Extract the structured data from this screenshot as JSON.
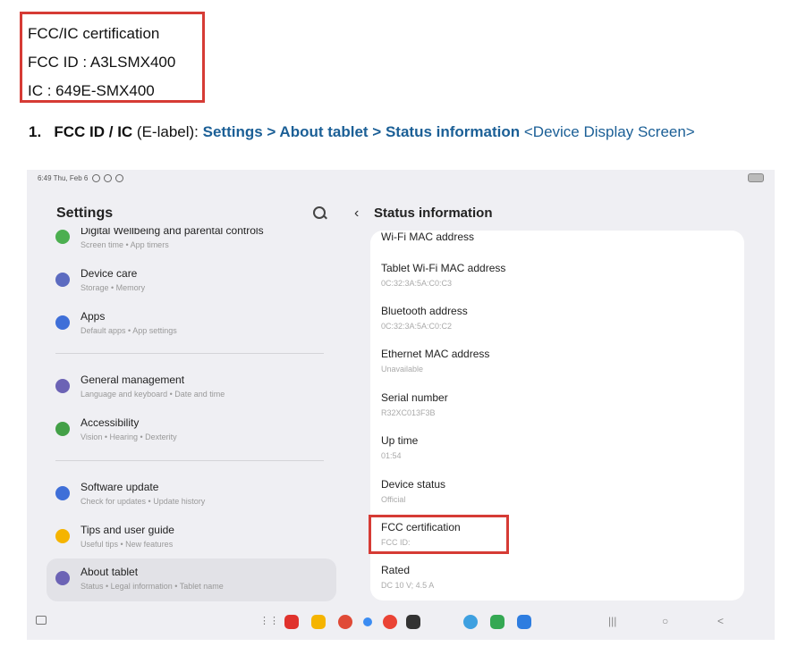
{
  "top_box": {
    "line1": "FCC/IC certification",
    "line2": "FCC ID : A3LSMX400",
    "line3": "IC : 649E-SMX400"
  },
  "instruction": {
    "number": "1.",
    "label": "FCC ID / IC",
    "elabel": " (E-label): ",
    "path": "Settings > About tablet > Status information",
    "suffix": " <Device Display Screen>"
  },
  "tablet": {
    "status_time": "6:49  Thu, Feb 6",
    "left_title": "Settings",
    "left_items": [
      {
        "title": "Digital Wellbeing and parental controls",
        "sub": "Screen time  •  App timers",
        "color": "#4caf50"
      },
      {
        "title": "Device care",
        "sub": "Storage  •  Memory",
        "color": "#5c6bc0"
      },
      {
        "title": "Apps",
        "sub": "Default apps  •  App settings",
        "color": "#3f6fd8"
      },
      {
        "title": "General management",
        "sub": "Language and keyboard  •  Date and time",
        "color": "#6c63b5"
      },
      {
        "title": "Accessibility",
        "sub": "Vision  •  Hearing  •  Dexterity",
        "color": "#43a047"
      },
      {
        "title": "Software update",
        "sub": "Check for updates  •  Update history",
        "color": "#3f6fd8"
      },
      {
        "title": "Tips and user guide",
        "sub": "Useful tips  •  New features",
        "color": "#f5b400"
      },
      {
        "title": "About tablet",
        "sub": "Status  •  Legal information  •  Tablet name",
        "color": "#6c63b5"
      }
    ],
    "right_title": "Status information",
    "right_items": [
      {
        "title": "Wi-Fi MAC address",
        "sub": ""
      },
      {
        "title": "Tablet Wi-Fi MAC address",
        "sub": "0C:32:3A:5A:C0:C3"
      },
      {
        "title": "Bluetooth address",
        "sub": "0C:32:3A:5A:C0:C2"
      },
      {
        "title": "Ethernet MAC address",
        "sub": "Unavailable"
      },
      {
        "title": "Serial number",
        "sub": "R32XC013F3B"
      },
      {
        "title": "Up time",
        "sub": "01:54"
      },
      {
        "title": "Device status",
        "sub": "Official"
      },
      {
        "title": "FCC certification",
        "sub": "FCC ID:"
      },
      {
        "title": "Rated",
        "sub": "DC 10 V; 4.5 A"
      }
    ]
  },
  "colors": {
    "highlight": "#d63b35",
    "link_blue": "#1b5f96"
  }
}
